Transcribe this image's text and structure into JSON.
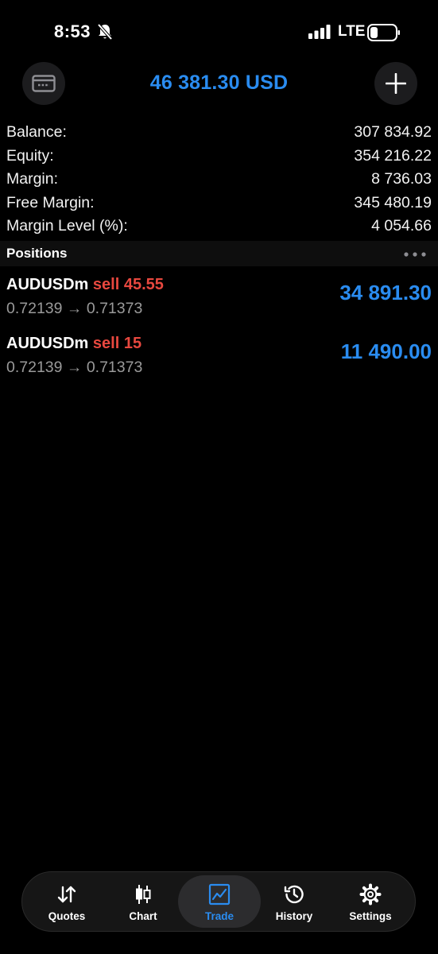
{
  "status_bar": {
    "time": "8:53",
    "network": "LTE"
  },
  "header": {
    "balance_title": "46 381.30 USD",
    "left_icon": "wallet-icon",
    "right_icon": "plus-icon"
  },
  "summary": [
    {
      "label": "Balance:",
      "value": "307 834.92"
    },
    {
      "label": "Equity:",
      "value": "354 216.22"
    },
    {
      "label": "Margin:",
      "value": "8 736.03"
    },
    {
      "label": "Free Margin:",
      "value": "345 480.19"
    },
    {
      "label": "Margin Level (%):",
      "value": "4 054.66"
    }
  ],
  "positions": {
    "title": "Positions",
    "items": [
      {
        "symbol": "AUDUSDm",
        "side": "sell 45.55",
        "prices": "0.72139 → 0.71373",
        "profit": "34 891.30"
      },
      {
        "symbol": "AUDUSDm",
        "side": "sell 15",
        "prices": "0.72139 → 0.71373",
        "profit": "11 490.00"
      }
    ]
  },
  "tabs": [
    {
      "label": "Quotes",
      "icon": "quotes-icon"
    },
    {
      "label": "Chart",
      "icon": "chart-icon"
    },
    {
      "label": "Trade",
      "icon": "trade-icon",
      "active": true
    },
    {
      "label": "History",
      "icon": "history-icon"
    },
    {
      "label": "Settings",
      "icon": "settings-icon"
    }
  ],
  "colors": {
    "accent": "#2a8cf0",
    "sell": "#e8483f",
    "background": "#000000"
  }
}
